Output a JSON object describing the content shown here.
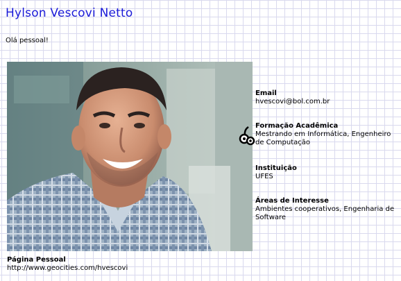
{
  "header": {
    "name": "Hylson Vescovi Netto"
  },
  "greeting": "Olá pessoal!",
  "info": [
    {
      "label": "Email",
      "value": "hvescovi@bol.com.br"
    },
    {
      "label": "Formação Acadêmica",
      "value": "Mestrando em Informática, Engenheiro de Computação"
    },
    {
      "label": "Instituição",
      "value": "UFES"
    },
    {
      "label": "Áreas de Interesse",
      "value": "Ambientes cooperativos, Engenharia de Software"
    }
  ],
  "personal_page": {
    "label": "Página Pessoal",
    "value": "http://www.geocities.com/hvescovi"
  },
  "icons": {
    "photo": "portrait-photo",
    "side": "glasses-icon"
  },
  "colors": {
    "title": "#1a1ad8",
    "grid": "#d9d9ee"
  }
}
